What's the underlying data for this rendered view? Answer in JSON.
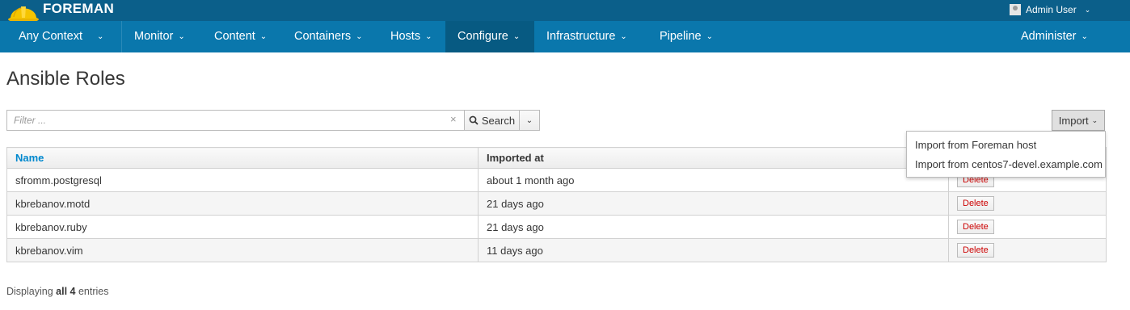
{
  "app": {
    "brand": "FOREMAN",
    "user": "Admin User",
    "colors": {
      "topbar": "#0b5f8a",
      "navbar": "#0a77ac",
      "nav_active": "#075a82",
      "link": "#0088ce",
      "danger": "#cc0000"
    }
  },
  "nav": {
    "context": "Any Context",
    "items": [
      "Monitor",
      "Content",
      "Containers",
      "Hosts",
      "Configure",
      "Infrastructure",
      "Pipeline"
    ],
    "active": "Configure",
    "admin": "Administer"
  },
  "page": {
    "title": "Ansible Roles"
  },
  "search": {
    "placeholder": "Filter ...",
    "button_label": "Search",
    "icons": {
      "search": "search-icon",
      "clear": "close-icon",
      "dropdown": "chevron-down-icon"
    }
  },
  "import": {
    "button_label": "Import",
    "menu": [
      "Import from Foreman host",
      "Import from centos7-devel.example.com"
    ]
  },
  "table": {
    "columns": [
      "Name",
      "Imported at",
      ""
    ],
    "rows": [
      {
        "name": "sfromm.postgresql",
        "imported_at": "about 1 month ago",
        "action": "Delete"
      },
      {
        "name": "kbrebanov.motd",
        "imported_at": "21 days ago",
        "action": "Delete"
      },
      {
        "name": "kbrebanov.ruby",
        "imported_at": "21 days ago",
        "action": "Delete"
      },
      {
        "name": "kbrebanov.vim",
        "imported_at": "11 days ago",
        "action": "Delete"
      }
    ]
  },
  "footer": {
    "prefix": "Displaying",
    "count": "all 4",
    "suffix": "entries"
  }
}
